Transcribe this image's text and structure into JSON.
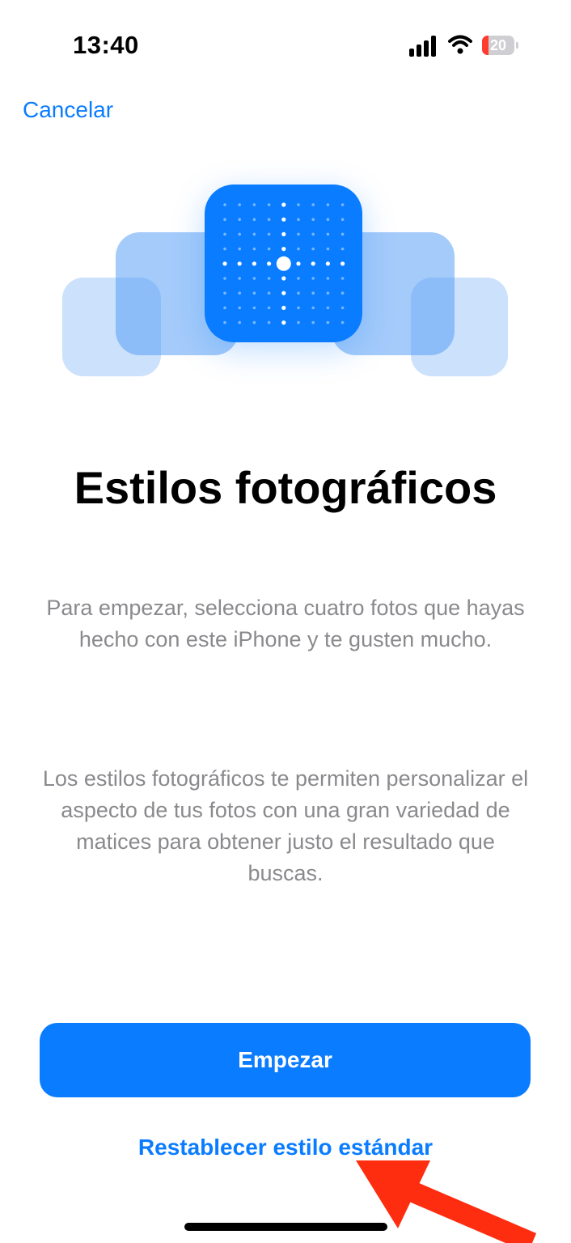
{
  "status_bar": {
    "time": "13:40",
    "battery_level": "20",
    "battery_color": "#ff3b30"
  },
  "nav": {
    "cancel_label": "Cancelar"
  },
  "hero": {
    "icon": "photographic-styles-grid-icon",
    "accent_color": "#0a7cff"
  },
  "content": {
    "title": "Estilos fotográficos",
    "paragraph_1": "Para empezar, selecciona cuatro fotos que hayas hecho con este iPhone y te gusten mucho.",
    "paragraph_2": "Los estilos fotográficos te permiten personalizar el aspecto de tus fotos con una gran variedad de matices para obtener justo el resultado que buscas."
  },
  "actions": {
    "primary_label": "Empezar",
    "secondary_label": "Restablecer estilo estándar"
  },
  "annotation": {
    "arrow_color": "#ff2d10"
  }
}
